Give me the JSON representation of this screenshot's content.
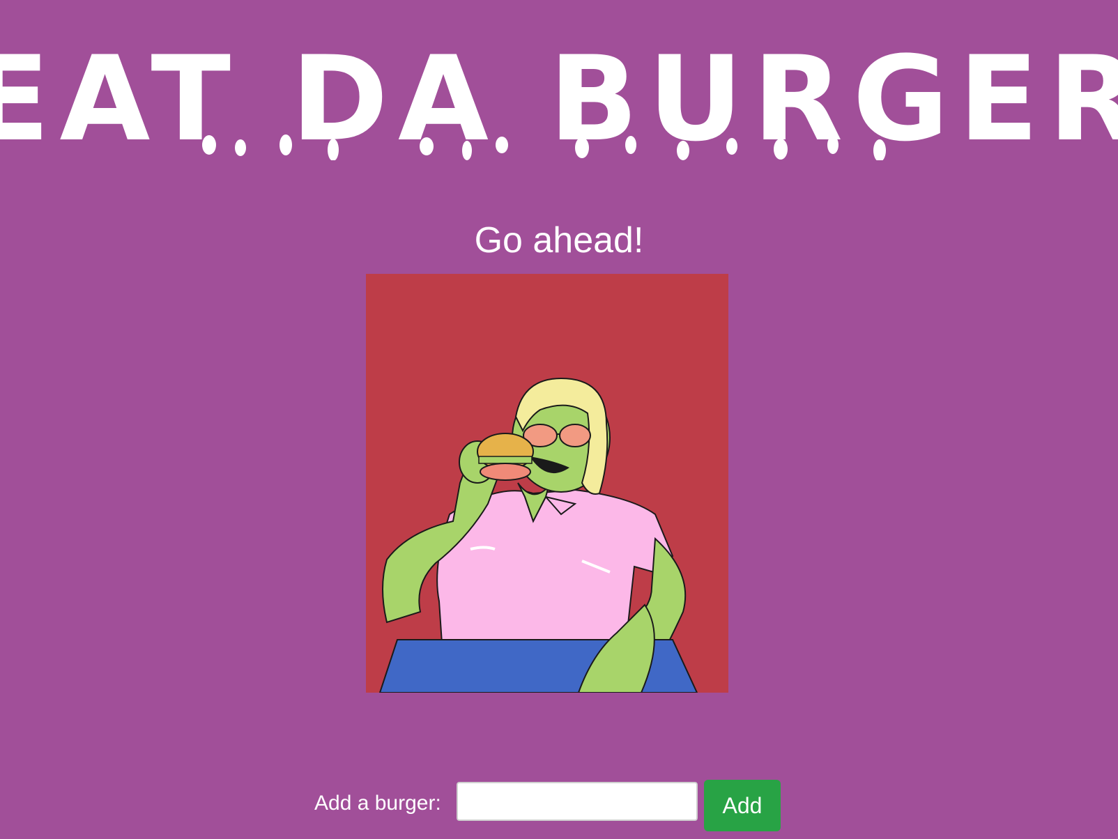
{
  "header": {
    "title": "EAT DA BURGER",
    "subtitle": "Go ahead!"
  },
  "illustration": {
    "name": "person-eating-burger-illustration",
    "colors": {
      "background": "#be3d48",
      "table": "#4068c6",
      "skin": "#a8d46a",
      "shirt": "#fcb8e8",
      "hair": "#f4ec9c",
      "glasses": "#f29a82"
    }
  },
  "form": {
    "label": "Add a burger:",
    "input_value": "",
    "input_placeholder": "",
    "button_label": "Add"
  },
  "theme": {
    "page_background": "#a14f99",
    "text": "#ffffff",
    "button": "#28a345"
  }
}
